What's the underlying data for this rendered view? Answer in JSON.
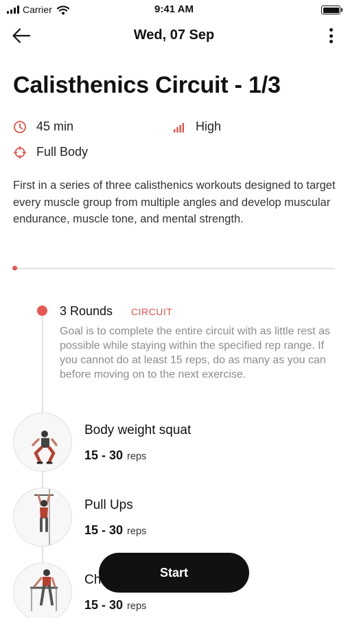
{
  "status_bar": {
    "carrier": "Carrier",
    "time": "9:41 AM"
  },
  "header": {
    "date": "Wed, 07 Sep"
  },
  "workout": {
    "title": "Calisthenics Circuit - 1/3",
    "duration": "45 min",
    "intensity": "High",
    "focus": "Full Body",
    "description": "First in a series of three calisthenics workouts designed to target every muscle group from multiple angles and develop muscular endurance, muscle tone, and mental strength."
  },
  "circuit": {
    "rounds": "3 Rounds",
    "tag": "CIRCUIT",
    "goal": "Goal is to complete the entire circuit with as little rest as possible while staying within the specified rep range. If you cannot do at least 15 reps, do as many as you can before moving on to the next exercise."
  },
  "exercises": [
    {
      "name": "Body weight squat",
      "reps": "15 - 30",
      "unit": "reps"
    },
    {
      "name": "Pull Ups",
      "reps": "15 - 30",
      "unit": "reps"
    },
    {
      "name": "Ch",
      "reps": "15 - 30",
      "unit": "reps"
    }
  ],
  "actions": {
    "start": "Start"
  },
  "colors": {
    "accent": "#e2524a",
    "button": "#111111",
    "muted": "#8c8c8c",
    "line": "#e2e2e2"
  }
}
